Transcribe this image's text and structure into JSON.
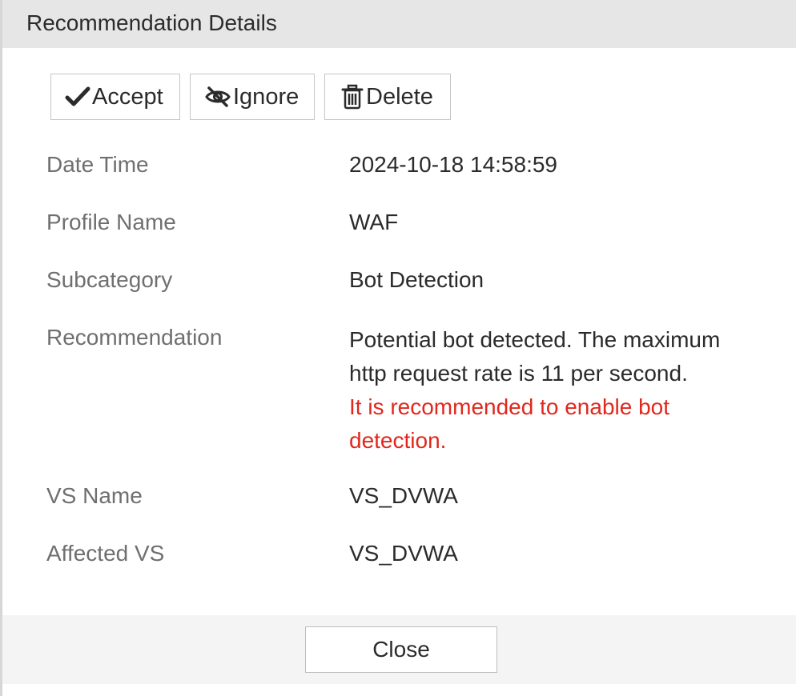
{
  "dialog": {
    "title": "Recommendation Details"
  },
  "toolbar": {
    "accept_label": "Accept",
    "accept_icon": "check-icon",
    "ignore_label": "Ignore",
    "ignore_icon": "eye-slash-icon",
    "delete_label": "Delete",
    "delete_icon": "trash-icon"
  },
  "details": {
    "date_time_label": "Date Time",
    "date_time_value": "2024-10-18 14:58:59",
    "profile_name_label": "Profile Name",
    "profile_name_value": "WAF",
    "subcategory_label": "Subcategory",
    "subcategory_value": "Bot Detection",
    "recommendation_label": "Recommendation",
    "recommendation_lines": [
      "Potential bot detected. The maximum",
      "http request rate is 11 per second."
    ],
    "recommendation_warning_lines": [
      "It is recommended to enable bot",
      "detection."
    ],
    "vs_name_label": "VS Name",
    "vs_name_value": "VS_DVWA",
    "affected_vs_label": "Affected VS",
    "affected_vs_value": "VS_DVWA"
  },
  "footer": {
    "close_label": "Close"
  },
  "colors": {
    "warning": "#e0281d",
    "titlebar_bg": "#e6e6e6",
    "label_text": "#6f6f6f",
    "value_text": "#2b2b2b"
  }
}
